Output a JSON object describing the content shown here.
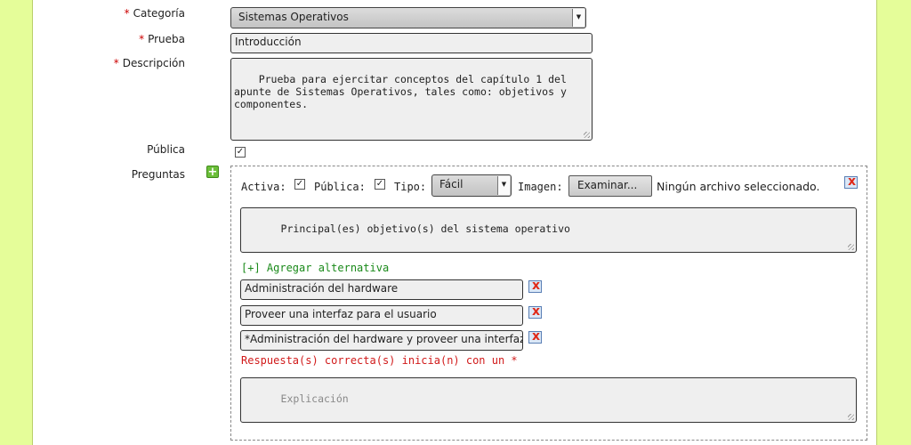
{
  "form": {
    "categoria": {
      "label": "Categoría",
      "value": "Sistemas Operativos"
    },
    "prueba": {
      "label": "Prueba",
      "value": "Introducción"
    },
    "descripcion": {
      "label": "Descripción",
      "value": "Prueba para ejercitar conceptos del capítulo 1 del\napunte de Sistemas Operativos, tales como: objetivos y\ncomponentes."
    },
    "publica": {
      "label": "Pública",
      "checked": true
    },
    "preguntas": {
      "label": "Preguntas"
    },
    "required_mark": "*"
  },
  "question": {
    "activa_label": "Activa:",
    "publica_label": "Pública:",
    "tipo_label": "Tipo:",
    "tipo_value": "Fácil",
    "imagen_label": "Imagen:",
    "examinar_button": "Examinar...",
    "file_status": "Ningún archivo seleccionado.",
    "text": "Principal(es) objetivo(s) del sistema operativo",
    "add_alternative": "[+] Agregar alternativa",
    "alternatives": [
      "Administración del hardware",
      "Proveer una interfaz para el usuario",
      "*Administración del hardware y proveer una interfaz para el usuario"
    ],
    "hint": "Respuesta(s) correcta(s) inicia(n) con un *",
    "explanation_placeholder": "Explicación"
  },
  "icons": {
    "check": "✓",
    "delete": "x",
    "plus": "+",
    "dropdown": "▼"
  },
  "colors": {
    "page_bg": "#e5fd99",
    "required": "#cc0000",
    "add_link": "#1a8a1a",
    "hint": "#d11a1a"
  }
}
